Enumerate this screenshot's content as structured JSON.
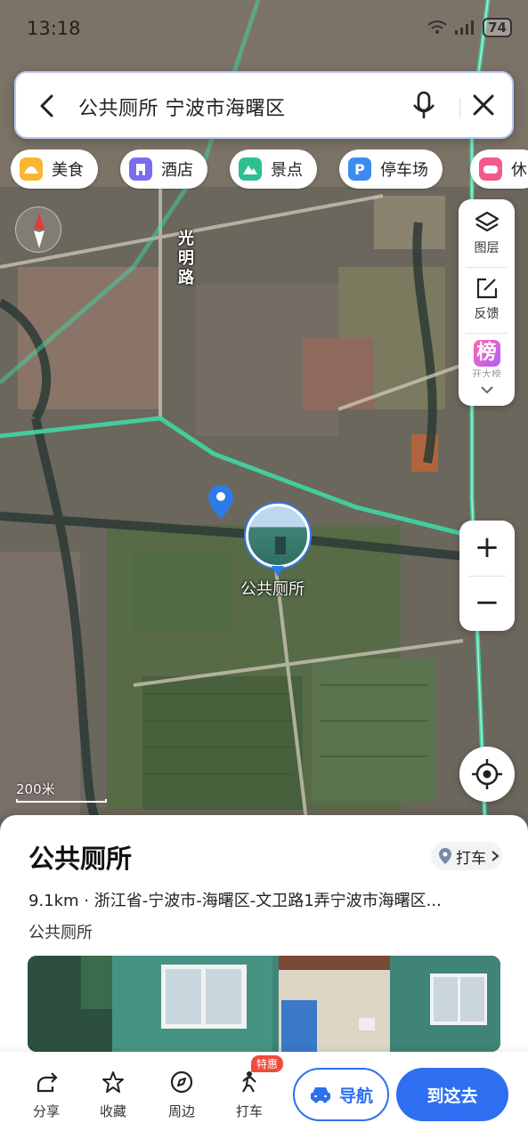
{
  "status_bar": {
    "time": "13:18",
    "battery": "74"
  },
  "search": {
    "query": "公共厕所 宁波市海曙区"
  },
  "categories": [
    {
      "label": "美食",
      "icon": "food-icon",
      "color": "#f7b731"
    },
    {
      "label": "酒店",
      "icon": "hotel-icon",
      "color": "#7b6cf0"
    },
    {
      "label": "景点",
      "icon": "scenic-icon",
      "color": "#2ebf8f"
    },
    {
      "label": "停车场",
      "icon": "parking-icon",
      "color": "#3b8cf0"
    },
    {
      "label": "休",
      "icon": "leisure-icon",
      "color": "#f25a8a"
    }
  ],
  "tools": {
    "layers_label": "图层",
    "feedback_label": "反馈",
    "ranking_label": "榜",
    "ranking_sub": "开大榜"
  },
  "map": {
    "road_label": "光明路",
    "poi_label": "公共厕所",
    "scale_label": "200米"
  },
  "place": {
    "title": "公共厕所",
    "taxi_chip": "打车",
    "address": "9.1km · 浙江省-宁波市-海曙区-文卫路1弄宁波市海曙区...",
    "category": "公共厕所"
  },
  "actions": {
    "share": "分享",
    "favorite": "收藏",
    "nearby": "周边",
    "taxi": "打车",
    "taxi_badge": "特惠",
    "navigate": "导航",
    "go_here": "到这去"
  },
  "colors": {
    "accent": "#2d6ff0",
    "route": "#3fd7a5",
    "badge": "#f04a3c"
  }
}
